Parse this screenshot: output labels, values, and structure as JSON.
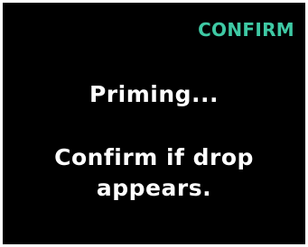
{
  "header": {
    "confirm_label": "CONFIRM"
  },
  "main": {
    "status_text": "Priming...",
    "instruction_line1": "Confirm if drop",
    "instruction_line2": "appears."
  },
  "colors": {
    "background": "#000000",
    "accent": "#3ec9a4",
    "text": "#ffffff"
  }
}
